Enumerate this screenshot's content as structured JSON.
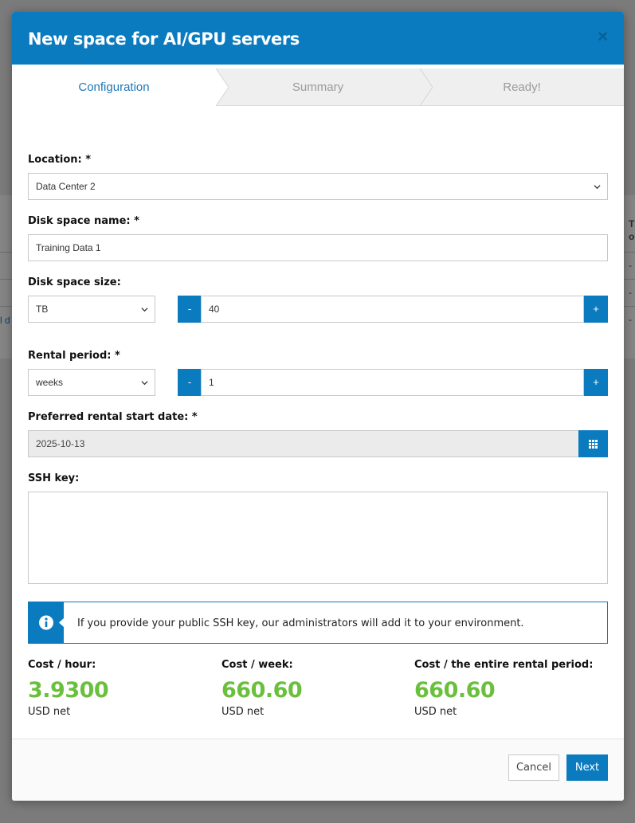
{
  "background": {
    "side_header": "T\no",
    "side_link": "l d",
    "dashes": [
      "-",
      "-",
      "-"
    ]
  },
  "modal": {
    "title": "New space for AI/GPU servers",
    "close_glyph": "×",
    "steps": [
      {
        "label": "Configuration",
        "active": true
      },
      {
        "label": "Summary",
        "active": false
      },
      {
        "label": "Ready!",
        "active": false
      }
    ]
  },
  "form": {
    "location": {
      "label": "Location: *",
      "value": "Data Center 2"
    },
    "disk_name": {
      "label": "Disk space name: *",
      "value": "Training Data 1"
    },
    "disk_size": {
      "label": "Disk space size:",
      "unit": "TB",
      "minus": "-",
      "plus": "+",
      "value": "40"
    },
    "rental_period": {
      "label": "Rental period: *",
      "unit": "weeks",
      "minus": "-",
      "plus": "+",
      "value": "1"
    },
    "start_date": {
      "label": "Preferred rental start date: *",
      "value": "2025-10-13"
    },
    "ssh_key": {
      "label": "SSH key:",
      "value": ""
    },
    "info": "If you provide your public SSH key, our administrators will add it to your environment."
  },
  "costs": [
    {
      "label": "Cost / hour:",
      "value": "3.9300",
      "unit": "USD net"
    },
    {
      "label": "Cost / week:",
      "value": "660.60",
      "unit": "USD net"
    },
    {
      "label": "Cost / the entire rental period:",
      "value": "660.60",
      "unit": "USD net"
    }
  ],
  "footer": {
    "cancel_label": "Cancel",
    "next_label": "Next"
  },
  "colors": {
    "accent": "#0a7bbf",
    "cost_green": "#6abf3c",
    "active_step_text": "#1f78b4"
  }
}
